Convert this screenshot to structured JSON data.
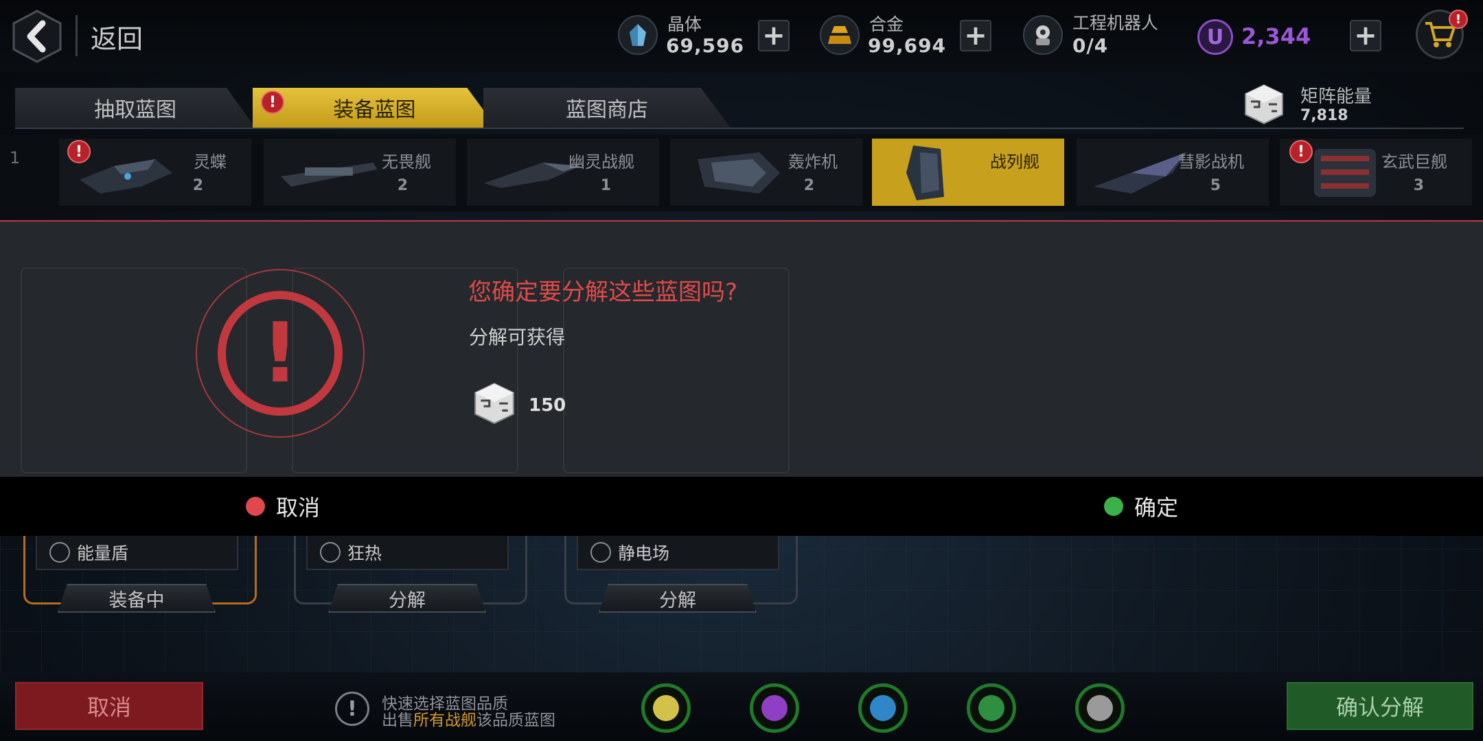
{
  "header": {
    "back_label": "返回",
    "resources": [
      {
        "name": "晶体",
        "value": "69,596",
        "icon": "crystal-icon"
      },
      {
        "name": "合金",
        "value": "99,694",
        "icon": "alloy-icon"
      },
      {
        "name": "工程机器人",
        "value": "0/4",
        "icon": "robot-icon"
      }
    ],
    "premium": {
      "icon_letter": "U",
      "value": "2,344",
      "color": "#9a57d6"
    },
    "shop_badge": "!"
  },
  "tabs": [
    {
      "label": "抽取蓝图",
      "active": false
    },
    {
      "label": "装备蓝图",
      "active": true,
      "badge": "!"
    },
    {
      "label": "蓝图商店",
      "active": false
    }
  ],
  "matrix_energy": {
    "label": "矩阵能量",
    "value": "7,818"
  },
  "ships": [
    {
      "name": "灵蝶",
      "count": "2",
      "badge": "!"
    },
    {
      "name": "无畏舰",
      "count": "2"
    },
    {
      "name": "幽灵战舰",
      "count": "1"
    },
    {
      "name": "轰炸机",
      "count": "2"
    },
    {
      "name": "战列舰",
      "count": "",
      "selected": true
    },
    {
      "name": "彗影战机",
      "count": "5"
    },
    {
      "name": "玄武巨舰",
      "count": "3",
      "badge": "!"
    }
  ],
  "ship_strip_edge_digit": "1",
  "dialog": {
    "title": "您确定要分解这些蓝图吗?",
    "subtitle": "分解可获得",
    "reward_value": "150",
    "warning_symbol": "!",
    "cancel_label": "取消",
    "confirm_label": "确定",
    "cancel_color": "#e0484e",
    "confirm_color": "#3bb14a"
  },
  "cards": [
    {
      "skill": "能量盾",
      "button": "装备中",
      "equipped": true
    },
    {
      "skill": "狂热",
      "button": "分解",
      "equipped": false
    },
    {
      "skill": "静电场",
      "button": "分解",
      "equipped": false
    }
  ],
  "bottom": {
    "cancel_label": "取消",
    "confirm_label": "确认分解",
    "hint_symbol": "!",
    "hint_line1": "快速选择蓝图品质",
    "hint_line2_pre": "出售",
    "hint_line2_highlight": "所有战舰",
    "hint_line2_post": "该品质蓝图",
    "qualities": [
      {
        "name": "yellow",
        "color": "#d3c24a"
      },
      {
        "name": "purple",
        "color": "#8e3fc4"
      },
      {
        "name": "blue",
        "color": "#2f86c8"
      },
      {
        "name": "green",
        "color": "#2d8f3f"
      },
      {
        "name": "gray",
        "color": "#9a9a9a"
      }
    ]
  }
}
